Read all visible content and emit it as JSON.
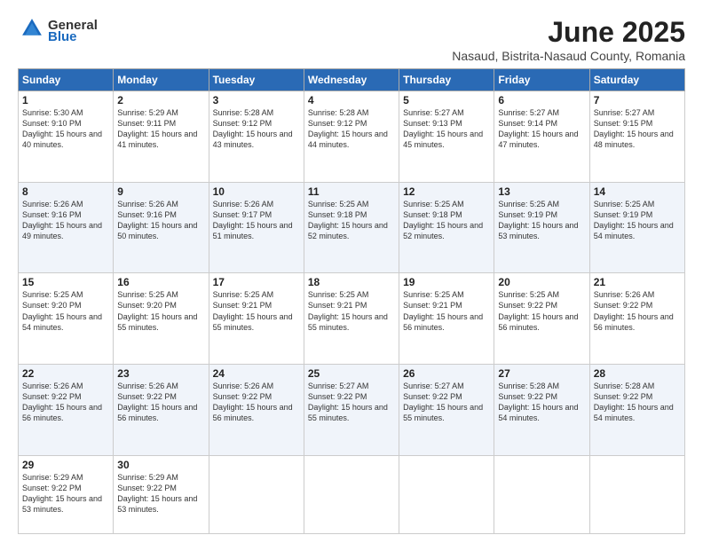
{
  "logo": {
    "general": "General",
    "blue": "Blue"
  },
  "header": {
    "title": "June 2025",
    "subtitle": "Nasaud, Bistrita-Nasaud County, Romania"
  },
  "weekdays": [
    "Sunday",
    "Monday",
    "Tuesday",
    "Wednesday",
    "Thursday",
    "Friday",
    "Saturday"
  ],
  "weeks": [
    [
      {
        "day": 1,
        "sunrise": "5:30 AM",
        "sunset": "9:10 PM",
        "daylight": "15 hours and 40 minutes."
      },
      {
        "day": 2,
        "sunrise": "5:29 AM",
        "sunset": "9:11 PM",
        "daylight": "15 hours and 41 minutes."
      },
      {
        "day": 3,
        "sunrise": "5:28 AM",
        "sunset": "9:12 PM",
        "daylight": "15 hours and 43 minutes."
      },
      {
        "day": 4,
        "sunrise": "5:28 AM",
        "sunset": "9:12 PM",
        "daylight": "15 hours and 44 minutes."
      },
      {
        "day": 5,
        "sunrise": "5:27 AM",
        "sunset": "9:13 PM",
        "daylight": "15 hours and 45 minutes."
      },
      {
        "day": 6,
        "sunrise": "5:27 AM",
        "sunset": "9:14 PM",
        "daylight": "15 hours and 47 minutes."
      },
      {
        "day": 7,
        "sunrise": "5:27 AM",
        "sunset": "9:15 PM",
        "daylight": "15 hours and 48 minutes."
      }
    ],
    [
      {
        "day": 8,
        "sunrise": "5:26 AM",
        "sunset": "9:16 PM",
        "daylight": "15 hours and 49 minutes."
      },
      {
        "day": 9,
        "sunrise": "5:26 AM",
        "sunset": "9:16 PM",
        "daylight": "15 hours and 50 minutes."
      },
      {
        "day": 10,
        "sunrise": "5:26 AM",
        "sunset": "9:17 PM",
        "daylight": "15 hours and 51 minutes."
      },
      {
        "day": 11,
        "sunrise": "5:25 AM",
        "sunset": "9:18 PM",
        "daylight": "15 hours and 52 minutes."
      },
      {
        "day": 12,
        "sunrise": "5:25 AM",
        "sunset": "9:18 PM",
        "daylight": "15 hours and 52 minutes."
      },
      {
        "day": 13,
        "sunrise": "5:25 AM",
        "sunset": "9:19 PM",
        "daylight": "15 hours and 53 minutes."
      },
      {
        "day": 14,
        "sunrise": "5:25 AM",
        "sunset": "9:19 PM",
        "daylight": "15 hours and 54 minutes."
      }
    ],
    [
      {
        "day": 15,
        "sunrise": "5:25 AM",
        "sunset": "9:20 PM",
        "daylight": "15 hours and 54 minutes."
      },
      {
        "day": 16,
        "sunrise": "5:25 AM",
        "sunset": "9:20 PM",
        "daylight": "15 hours and 55 minutes."
      },
      {
        "day": 17,
        "sunrise": "5:25 AM",
        "sunset": "9:21 PM",
        "daylight": "15 hours and 55 minutes."
      },
      {
        "day": 18,
        "sunrise": "5:25 AM",
        "sunset": "9:21 PM",
        "daylight": "15 hours and 55 minutes."
      },
      {
        "day": 19,
        "sunrise": "5:25 AM",
        "sunset": "9:21 PM",
        "daylight": "15 hours and 56 minutes."
      },
      {
        "day": 20,
        "sunrise": "5:25 AM",
        "sunset": "9:22 PM",
        "daylight": "15 hours and 56 minutes."
      },
      {
        "day": 21,
        "sunrise": "5:26 AM",
        "sunset": "9:22 PM",
        "daylight": "15 hours and 56 minutes."
      }
    ],
    [
      {
        "day": 22,
        "sunrise": "5:26 AM",
        "sunset": "9:22 PM",
        "daylight": "15 hours and 56 minutes."
      },
      {
        "day": 23,
        "sunrise": "5:26 AM",
        "sunset": "9:22 PM",
        "daylight": "15 hours and 56 minutes."
      },
      {
        "day": 24,
        "sunrise": "5:26 AM",
        "sunset": "9:22 PM",
        "daylight": "15 hours and 56 minutes."
      },
      {
        "day": 25,
        "sunrise": "5:27 AM",
        "sunset": "9:22 PM",
        "daylight": "15 hours and 55 minutes."
      },
      {
        "day": 26,
        "sunrise": "5:27 AM",
        "sunset": "9:22 PM",
        "daylight": "15 hours and 55 minutes."
      },
      {
        "day": 27,
        "sunrise": "5:28 AM",
        "sunset": "9:22 PM",
        "daylight": "15 hours and 54 minutes."
      },
      {
        "day": 28,
        "sunrise": "5:28 AM",
        "sunset": "9:22 PM",
        "daylight": "15 hours and 54 minutes."
      }
    ],
    [
      {
        "day": 29,
        "sunrise": "5:29 AM",
        "sunset": "9:22 PM",
        "daylight": "15 hours and 53 minutes."
      },
      {
        "day": 30,
        "sunrise": "5:29 AM",
        "sunset": "9:22 PM",
        "daylight": "15 hours and 53 minutes."
      },
      null,
      null,
      null,
      null,
      null
    ]
  ]
}
